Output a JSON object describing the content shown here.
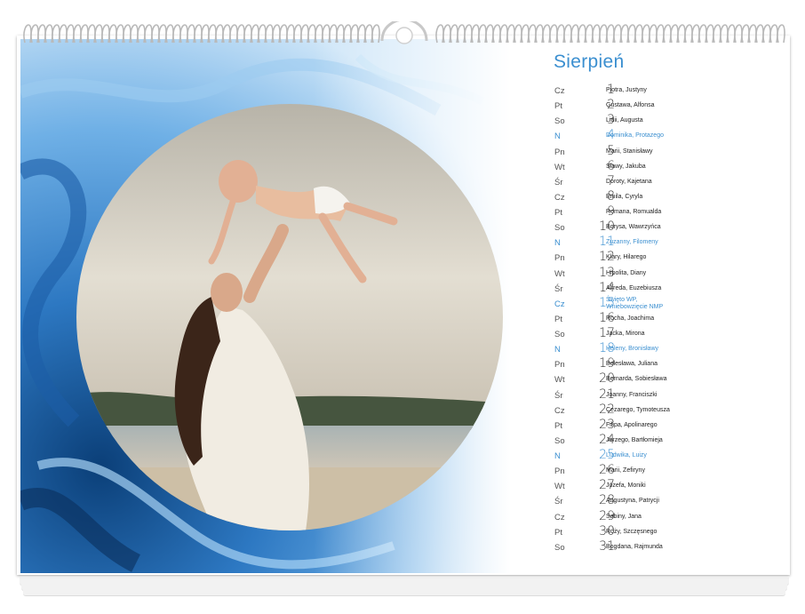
{
  "calendar": {
    "month": "Sierpień",
    "accent_color": "#3b8fd0",
    "days": [
      {
        "dow": "Cz",
        "day": "1",
        "names": "Piotra, Justyny"
      },
      {
        "dow": "Pt",
        "day": "2",
        "names": "Gustawa, Alfonsa"
      },
      {
        "dow": "So",
        "day": "3",
        "names": "Lidii, Augusta"
      },
      {
        "dow": "N",
        "day": "4",
        "names": "Dominika, Protazego",
        "highlight": true
      },
      {
        "dow": "Pn",
        "day": "5",
        "names": "Marii, Stanisławy"
      },
      {
        "dow": "Wt",
        "day": "6",
        "names": "Sławy, Jakuba"
      },
      {
        "dow": "Śr",
        "day": "7",
        "names": "Doroty, Kajetana"
      },
      {
        "dow": "Cz",
        "day": "8",
        "names": "Emila, Cyryla"
      },
      {
        "dow": "Pt",
        "day": "9",
        "names": "Romana, Romualda"
      },
      {
        "dow": "So",
        "day": "10",
        "names": "Borysa, Wawrzyńca"
      },
      {
        "dow": "N",
        "day": "11",
        "names": "Zuzanny, Filomeny",
        "highlight": true
      },
      {
        "dow": "Pn",
        "day": "12",
        "names": "Klary, Hilarego"
      },
      {
        "dow": "Wt",
        "day": "13",
        "names": "Hipolita, Diany"
      },
      {
        "dow": "Śr",
        "day": "14",
        "names": "Alfreda, Euzebiusza"
      },
      {
        "dow": "Cz",
        "day": "15",
        "names": "Święto WP,\nWniebowzięcie NMP",
        "highlight": true
      },
      {
        "dow": "Pt",
        "day": "16",
        "names": "Rocha, Joachima"
      },
      {
        "dow": "So",
        "day": "17",
        "names": "Jacka, Mirona"
      },
      {
        "dow": "N",
        "day": "18",
        "names": "Heleny, Bronisławy",
        "highlight": true
      },
      {
        "dow": "Pn",
        "day": "19",
        "names": "Bolesława, Juliana"
      },
      {
        "dow": "Wt",
        "day": "20",
        "names": "Bernarda, Sobiesława"
      },
      {
        "dow": "Śr",
        "day": "21",
        "names": "Joanny, Franciszki"
      },
      {
        "dow": "Cz",
        "day": "22",
        "names": "Cezarego, Tymoteusza"
      },
      {
        "dow": "Pt",
        "day": "23",
        "names": "Filipa, Apolinarego"
      },
      {
        "dow": "So",
        "day": "24",
        "names": "Jerzego, Bartłomieja"
      },
      {
        "dow": "N",
        "day": "25",
        "names": "Ludwika, Luizy",
        "highlight": true
      },
      {
        "dow": "Pn",
        "day": "26",
        "names": "Marii, Zefiryny"
      },
      {
        "dow": "Wt",
        "day": "27",
        "names": "Józefa, Moniki"
      },
      {
        "dow": "Śr",
        "day": "28",
        "names": "Augustyna, Patrycji"
      },
      {
        "dow": "Cz",
        "day": "29",
        "names": "Sabiny, Jana"
      },
      {
        "dow": "Pt",
        "day": "30",
        "names": "Róży, Szczęsnego"
      },
      {
        "dow": "So",
        "day": "31",
        "names": "Bogdana, Rajmunda"
      }
    ]
  }
}
